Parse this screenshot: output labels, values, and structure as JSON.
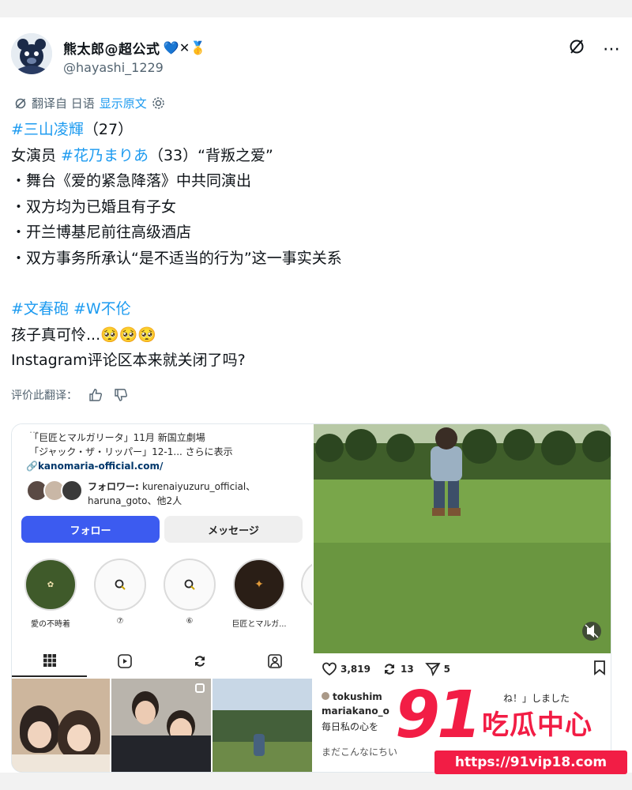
{
  "tweet": {
    "display_name": "熊太郎@超公式",
    "name_emojis": "💙✕🥇",
    "handle": "@hayashi_1229",
    "translated_from": "翻译自 日语",
    "show_original": "显示原文",
    "body": {
      "line1_tag": "#三山凌輝",
      "line1_rest": "（27）",
      "line2_pre": "女演员 ",
      "line2_tag": "#花乃まりあ",
      "line2_rest": "（33）“背叛之爱”",
      "line3": "・舞台《爱的紧急降落》中共同演出",
      "line4": "・双方均为已婚且有子女",
      "line5": "・开兰博基尼前往高级酒店",
      "line6": "・双方事务所承认“是不适当的行为”这一事实关系",
      "tag_a": "#文春砲",
      "tag_b": "#W不伦",
      "line8": "孩子真可怜...🥺🥺🥺",
      "line9": "Instagram评论区本来就关闭了吗?"
    },
    "rate_label": "评价此翻译："
  },
  "instagram_profile": {
    "stage_line1": "「巨匠とマルガリータ」11月 新国立劇場",
    "stage_line2": "「ジャック・ザ・リッパー」12-1... さらに表示",
    "website": "kanomaria-official.com/",
    "followers_prefix": "フォロワー: ",
    "followers_names": "kurenaiyuzuru_official、",
    "followers_more": "haruna_goto、他2人",
    "follow_button": "フォロー",
    "message_button": "メッセージ",
    "highlights": [
      "愛の不時着",
      "⑦",
      "⑥",
      "巨匠とマルガ..."
    ]
  },
  "instagram_post": {
    "likes": "3,819",
    "reposts": "13",
    "shares": "5",
    "comment1_user": "tokushim",
    "comment1_tail": "ね！」しました",
    "comment2": "mariakano_o",
    "comment3": "毎日私の心を",
    "comment4": "まだこんなにちい"
  },
  "watermark": {
    "number": "91",
    "text": "吃瓜中心",
    "url": "https://91vip18.com"
  },
  "colors": {
    "link_blue": "#1d9bf0",
    "instagram_blue": "#3c5bf0",
    "watermark_red": "#f21d45"
  }
}
